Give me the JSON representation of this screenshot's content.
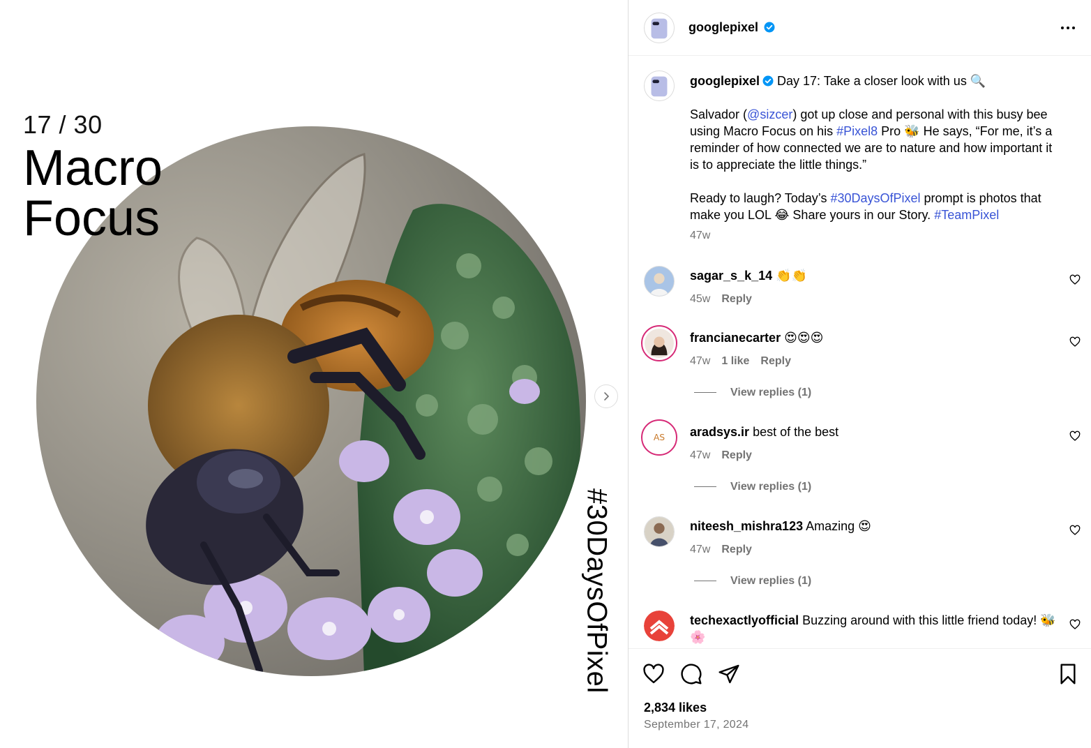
{
  "media": {
    "counter": "17 / 30",
    "headline_line1": "Macro",
    "headline_line2": "Focus",
    "vertical_tag": "#30DaysOfPixel"
  },
  "header": {
    "username": "googlepixel"
  },
  "caption": {
    "username": "googlepixel",
    "line1": " Day 17: Take a closer look with us 🔍",
    "p1a": "Salvador (",
    "mention": "@sizcer",
    "p1b": ") got up close and personal with this busy bee using Macro Focus on his ",
    "tag1": "#Pixel8",
    "p1c": " Pro 🐝 He says, “For me, it’s a reminder of how connected we are to nature and how important it is to appreciate the little things.”",
    "p2a": "Ready to laugh? Today’s ",
    "tag2": "#30DaysOfPixel",
    "p2b": " prompt is photos that make you LOL 😂 Share yours in our Story. ",
    "tag3": "#TeamPixel",
    "time": "47w"
  },
  "comments": [
    {
      "user": "sagar_s_k_14",
      "text": " 👏👏",
      "time": "45w",
      "likes": "",
      "reply": "Reply",
      "view_replies": ""
    },
    {
      "user": "francianecarter",
      "text": " 😍😍😍",
      "time": "47w",
      "likes": "1 like",
      "reply": "Reply",
      "view_replies": "View replies (1)"
    },
    {
      "user": "aradsys.ir",
      "text": " best of the best",
      "time": "47w",
      "likes": "",
      "reply": "Reply",
      "view_replies": "View replies (1)"
    },
    {
      "user": "niteesh_mishra123",
      "text": " Amazing 😍",
      "time": "47w",
      "likes": "",
      "reply": "Reply",
      "view_replies": "View replies (1)"
    },
    {
      "user": "techexactlyofficial",
      "text": " Buzzing around with this little friend today! 🐝🌸",
      "time": "",
      "likes": "",
      "reply": "",
      "view_replies": ""
    }
  ],
  "footer": {
    "likes": "2,834 likes",
    "date": "September 17, 2024"
  },
  "colors": {
    "link": "#3954d6",
    "verified": "#0095f6",
    "muted": "#737373",
    "border": "#dbdbdb"
  },
  "icons": [
    "verified-badge-icon",
    "more-options-icon",
    "heart-icon",
    "comment-icon",
    "share-icon",
    "bookmark-icon",
    "chevron-right-icon"
  ]
}
